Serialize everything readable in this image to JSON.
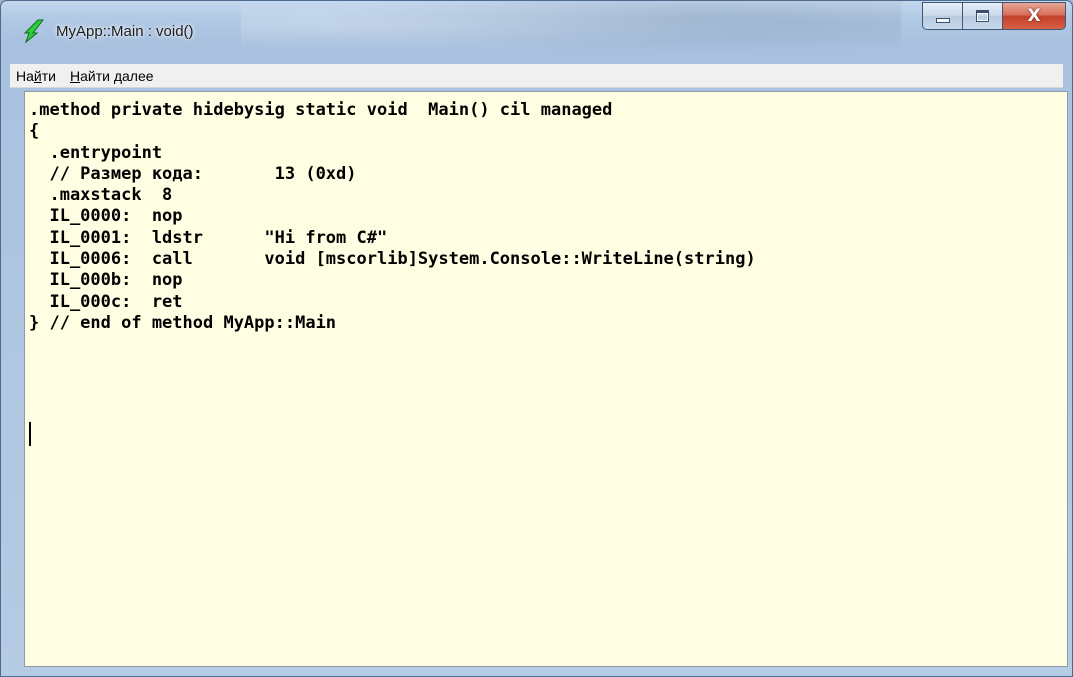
{
  "window": {
    "title": "MyApp::Main : void()",
    "icon": "lightning-app-icon",
    "close_symbol": "X"
  },
  "menu": {
    "items": [
      {
        "prefix": "На",
        "accel": "й",
        "suffix": "ти"
      },
      {
        "prefix": "",
        "accel": "Н",
        "suffix": "айти далее"
      }
    ]
  },
  "code": {
    "lines": [
      ".method private hidebysig static void  Main() cil managed",
      "{",
      "  .entrypoint",
      "  // Размер кода:       13 (0xd)",
      "  .maxstack  8",
      "  IL_0000:  nop",
      "  IL_0001:  ldstr      \"Hi from C#\"",
      "  IL_0006:  call       void [mscorlib]System.Console::WriteLine(string)",
      "  IL_000b:  nop",
      "  IL_000c:  ret",
      "} // end of method MyApp::Main"
    ]
  },
  "colors": {
    "editor_background": "#fffee2",
    "menubar_background": "#f0f0f0",
    "close_button": "#c4402a"
  }
}
